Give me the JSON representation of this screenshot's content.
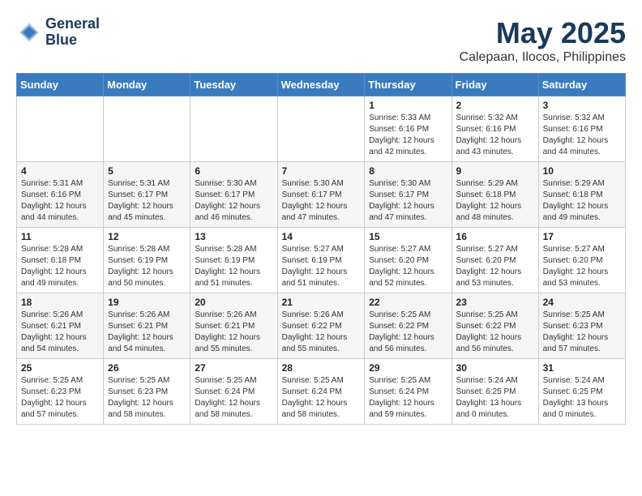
{
  "header": {
    "logo_line1": "General",
    "logo_line2": "Blue",
    "month_title": "May 2025",
    "location": "Calepaan, Ilocos, Philippines"
  },
  "weekdays": [
    "Sunday",
    "Monday",
    "Tuesday",
    "Wednesday",
    "Thursday",
    "Friday",
    "Saturday"
  ],
  "weeks": [
    [
      {
        "day": "",
        "info": ""
      },
      {
        "day": "",
        "info": ""
      },
      {
        "day": "",
        "info": ""
      },
      {
        "day": "",
        "info": ""
      },
      {
        "day": "1",
        "info": "Sunrise: 5:33 AM\nSunset: 6:16 PM\nDaylight: 12 hours\nand 42 minutes."
      },
      {
        "day": "2",
        "info": "Sunrise: 5:32 AM\nSunset: 6:16 PM\nDaylight: 12 hours\nand 43 minutes."
      },
      {
        "day": "3",
        "info": "Sunrise: 5:32 AM\nSunset: 6:16 PM\nDaylight: 12 hours\nand 44 minutes."
      }
    ],
    [
      {
        "day": "4",
        "info": "Sunrise: 5:31 AM\nSunset: 6:16 PM\nDaylight: 12 hours\nand 44 minutes."
      },
      {
        "day": "5",
        "info": "Sunrise: 5:31 AM\nSunset: 6:17 PM\nDaylight: 12 hours\nand 45 minutes."
      },
      {
        "day": "6",
        "info": "Sunrise: 5:30 AM\nSunset: 6:17 PM\nDaylight: 12 hours\nand 46 minutes."
      },
      {
        "day": "7",
        "info": "Sunrise: 5:30 AM\nSunset: 6:17 PM\nDaylight: 12 hours\nand 47 minutes."
      },
      {
        "day": "8",
        "info": "Sunrise: 5:30 AM\nSunset: 6:17 PM\nDaylight: 12 hours\nand 47 minutes."
      },
      {
        "day": "9",
        "info": "Sunrise: 5:29 AM\nSunset: 6:18 PM\nDaylight: 12 hours\nand 48 minutes."
      },
      {
        "day": "10",
        "info": "Sunrise: 5:29 AM\nSunset: 6:18 PM\nDaylight: 12 hours\nand 49 minutes."
      }
    ],
    [
      {
        "day": "11",
        "info": "Sunrise: 5:28 AM\nSunset: 6:18 PM\nDaylight: 12 hours\nand 49 minutes."
      },
      {
        "day": "12",
        "info": "Sunrise: 5:28 AM\nSunset: 6:19 PM\nDaylight: 12 hours\nand 50 minutes."
      },
      {
        "day": "13",
        "info": "Sunrise: 5:28 AM\nSunset: 6:19 PM\nDaylight: 12 hours\nand 51 minutes."
      },
      {
        "day": "14",
        "info": "Sunrise: 5:27 AM\nSunset: 6:19 PM\nDaylight: 12 hours\nand 51 minutes."
      },
      {
        "day": "15",
        "info": "Sunrise: 5:27 AM\nSunset: 6:20 PM\nDaylight: 12 hours\nand 52 minutes."
      },
      {
        "day": "16",
        "info": "Sunrise: 5:27 AM\nSunset: 6:20 PM\nDaylight: 12 hours\nand 53 minutes."
      },
      {
        "day": "17",
        "info": "Sunrise: 5:27 AM\nSunset: 6:20 PM\nDaylight: 12 hours\nand 53 minutes."
      }
    ],
    [
      {
        "day": "18",
        "info": "Sunrise: 5:26 AM\nSunset: 6:21 PM\nDaylight: 12 hours\nand 54 minutes."
      },
      {
        "day": "19",
        "info": "Sunrise: 5:26 AM\nSunset: 6:21 PM\nDaylight: 12 hours\nand 54 minutes."
      },
      {
        "day": "20",
        "info": "Sunrise: 5:26 AM\nSunset: 6:21 PM\nDaylight: 12 hours\nand 55 minutes."
      },
      {
        "day": "21",
        "info": "Sunrise: 5:26 AM\nSunset: 6:22 PM\nDaylight: 12 hours\nand 55 minutes."
      },
      {
        "day": "22",
        "info": "Sunrise: 5:25 AM\nSunset: 6:22 PM\nDaylight: 12 hours\nand 56 minutes."
      },
      {
        "day": "23",
        "info": "Sunrise: 5:25 AM\nSunset: 6:22 PM\nDaylight: 12 hours\nand 56 minutes."
      },
      {
        "day": "24",
        "info": "Sunrise: 5:25 AM\nSunset: 6:23 PM\nDaylight: 12 hours\nand 57 minutes."
      }
    ],
    [
      {
        "day": "25",
        "info": "Sunrise: 5:25 AM\nSunset: 6:23 PM\nDaylight: 12 hours\nand 57 minutes."
      },
      {
        "day": "26",
        "info": "Sunrise: 5:25 AM\nSunset: 6:23 PM\nDaylight: 12 hours\nand 58 minutes."
      },
      {
        "day": "27",
        "info": "Sunrise: 5:25 AM\nSunset: 6:24 PM\nDaylight: 12 hours\nand 58 minutes."
      },
      {
        "day": "28",
        "info": "Sunrise: 5:25 AM\nSunset: 6:24 PM\nDaylight: 12 hours\nand 58 minutes."
      },
      {
        "day": "29",
        "info": "Sunrise: 5:25 AM\nSunset: 6:24 PM\nDaylight: 12 hours\nand 59 minutes."
      },
      {
        "day": "30",
        "info": "Sunrise: 5:24 AM\nSunset: 6:25 PM\nDaylight: 13 hours\nand 0 minutes."
      },
      {
        "day": "31",
        "info": "Sunrise: 5:24 AM\nSunset: 6:25 PM\nDaylight: 13 hours\nand 0 minutes."
      }
    ]
  ]
}
